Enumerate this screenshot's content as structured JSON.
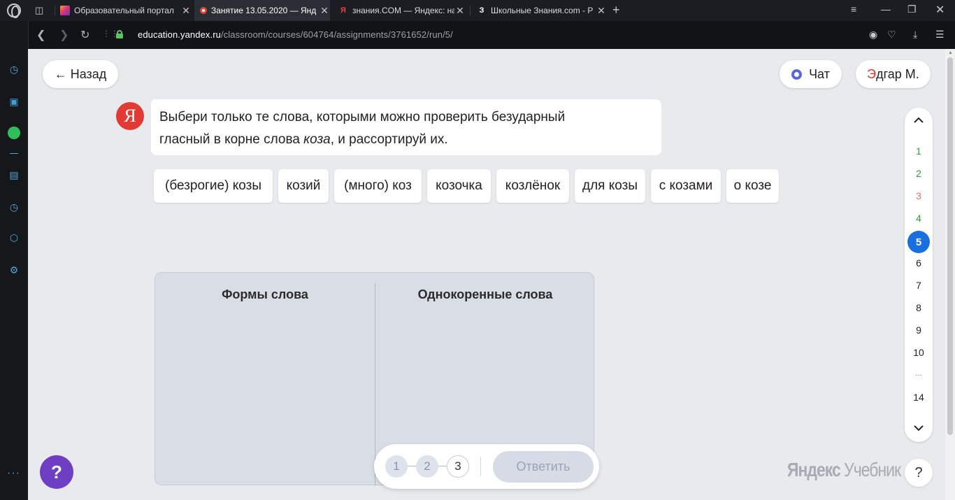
{
  "browser": {
    "tabs": [
      {
        "title": "Образовательный портал",
        "favicon": "instagram-gradient-icon"
      },
      {
        "title": "Занятие 13.05.2020 — Янд",
        "favicon": "yandex-education-icon"
      },
      {
        "title": "знания.COM — Яндекс: на",
        "favicon": "yandex-y-icon"
      },
      {
        "title": "Школьные Знания.com - Р",
        "favicon": "znania-z-icon"
      }
    ],
    "url_host": "education.yandex.ru",
    "url_path": "/classroom/courses/604764/assignments/3761652/run/5/"
  },
  "header": {
    "back_label": "← Назад",
    "chat_label": "Чат",
    "user_first_letter": "Э",
    "user_rest": "дгар М."
  },
  "task": {
    "avatar_letter": "Я",
    "line1": "Выбери только те слова, которыми можно проверить безударный",
    "line2_start": "гласный в корне слова ",
    "line2_italic": "коза",
    "line2_end": ", и рассортируй их."
  },
  "words": [
    "(безрогие) козы",
    "козий",
    "(много) коз",
    "козочка",
    "козлёнок",
    "для козы",
    "с козами",
    "о козе"
  ],
  "sort_columns": [
    "Формы слова",
    "Однокоренные слова"
  ],
  "stepper": {
    "steps": [
      "1",
      "2",
      "3"
    ],
    "answer_label": "Ответить"
  },
  "question_nav": {
    "items": [
      "1",
      "2",
      "3",
      "4",
      "5",
      "6",
      "7",
      "8",
      "9",
      "10",
      "...",
      "14"
    ],
    "statuses": [
      "correct",
      "correct",
      "wrong",
      "correct",
      "current",
      "none",
      "none",
      "none",
      "none",
      "none",
      "none",
      "none"
    ]
  },
  "brand": {
    "bold": "Яндекс",
    "light": "Учебник"
  },
  "help_label": "?",
  "colors": {
    "correct": "#27a635",
    "wrong": "#e8766a",
    "current": "#1a6fe0",
    "help": "#6e3fc2"
  }
}
